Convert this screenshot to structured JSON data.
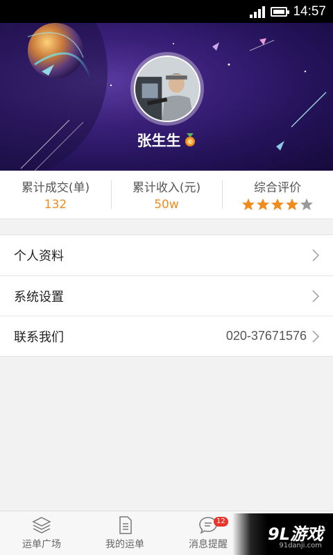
{
  "status_bar": {
    "time": "14:57",
    "icons": [
      "signal-icon",
      "battery-icon"
    ]
  },
  "profile": {
    "name": "张生生",
    "badge_icon": "medal-icon"
  },
  "stats": [
    {
      "label": "累计成交(单)",
      "value": "132"
    },
    {
      "label": "累计收入(元)",
      "value": "50w"
    },
    {
      "label": "综合评价",
      "rating": 4,
      "rating_max": 5
    }
  ],
  "colors": {
    "accent": "#f08c1e",
    "header_dark": "#24135a",
    "badge": "#e8352b",
    "star_off": "#9a9a9a"
  },
  "menu": [
    {
      "label": "个人资料",
      "value": ""
    },
    {
      "label": "系统设置",
      "value": ""
    },
    {
      "label": "联系我们",
      "value": "020-37671576"
    }
  ],
  "bottom_nav": [
    {
      "label": "运单广场",
      "icon": "layers-icon"
    },
    {
      "label": "我的运单",
      "icon": "document-icon"
    },
    {
      "label": "消息提醒",
      "icon": "chat-icon",
      "badge": "12"
    },
    {
      "label": "",
      "icon": ""
    }
  ],
  "watermark": {
    "logo": "9L游戏",
    "site": "91danji.com"
  }
}
